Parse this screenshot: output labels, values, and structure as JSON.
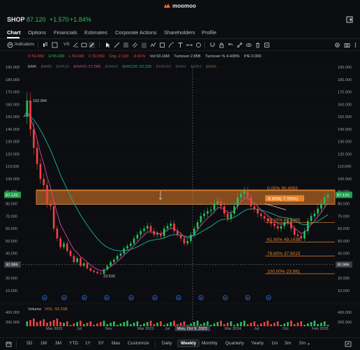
{
  "brand": {
    "name": "moomoo"
  },
  "ticker": {
    "symbol": "SHOP",
    "price": "87.120",
    "change": "+1.570",
    "change_pct": "+1.84%"
  },
  "tabs": [
    "Chart",
    "Options",
    "Financials",
    "Estimates",
    "Corporate Actions",
    "Shareholders",
    "Profile"
  ],
  "toolbar": {
    "indicators_label": "Indicators",
    "vs_label": "VS"
  },
  "ohlc": {
    "open": "O 52.450",
    "high": "H 55.630",
    "low": "L 50.690",
    "close": "C 51.550",
    "chg": "Chg -2.100",
    "pct": "-3.91%",
    "vol": "Vol 53.16M",
    "turnover": "Turnover 2.85B",
    "turnover_pct": "Turnover % 4.439%",
    "pe": "P/E 0.000"
  },
  "ema_row": {
    "ema": "EMA",
    "ema5": "EMA5",
    "ema10": "EMA10",
    "ema20": "EMA20: 57.088",
    "ema60": "EMA60",
    "ema120": "EMA120: 62.220",
    "ema250": "EMA250",
    "ema_a": "EMA1",
    "ema_b": "EMA1",
    "ema_c": "EMA1"
  },
  "colors": {
    "up": "#22c55e",
    "down": "#ef4444",
    "fib": "#e8822a",
    "ema20": "#d946a8",
    "ema120": "#14b8a6"
  },
  "chart_data": {
    "type": "candlestick",
    "y_ticks": [
      "190.000",
      "180.000",
      "170.000",
      "160.000",
      "150.000",
      "140.000",
      "130.000",
      "120.000",
      "110.000",
      "100.000",
      "90.000",
      "80.000",
      "70.000",
      "60.000",
      "50.000",
      "40.000",
      "30.000",
      "20.000",
      "10.000"
    ],
    "x_ticks": [
      "Mar 2022",
      "Jul",
      "Nov",
      "Mar 2023",
      "Jul",
      "Mar 2024",
      "Jul",
      "Oct",
      "Feb 2025"
    ],
    "crosshair_label": "Mon, Oct 9, 2023",
    "current_price_label": "87.120",
    "crosshair_price_label": "30.986",
    "high_label": "162.994",
    "low_label": "23.630",
    "measure_label": "-6.856(-7.55%)",
    "fib_levels": [
      {
        "label": "0.00% 90.4993",
        "value": 90.4993
      },
      {
        "label": "38.20% 64.9365",
        "value": 64.9365
      },
      {
        "label": "61.80% 49.1438",
        "value": 49.1438
      },
      {
        "label": "78.60% 37.9015",
        "value": 37.9015
      },
      {
        "label": "100.00% 23.581",
        "value": 23.581
      }
    ],
    "ylim": [
      10,
      190
    ],
    "volume_label": "Volume",
    "volume_value": "VOL: 53.158",
    "volume_ticks": [
      "400.000",
      "200.000"
    ]
  },
  "bottom": {
    "ranges": [
      "5D",
      "1M",
      "3M",
      "YTD",
      "1Y",
      "5Y",
      "Max",
      "Customize"
    ],
    "periods": [
      "Daily",
      "Weekly",
      "Monthly",
      "Quarterly",
      "Yearly",
      "1m",
      "3m",
      "5m"
    ]
  }
}
